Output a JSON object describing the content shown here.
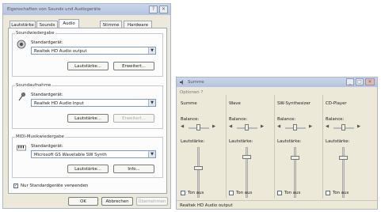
{
  "dialog": {
    "title": "Eigenschaften von Sounds und Audiogeräte",
    "tabs": [
      "Lautstärke",
      "Sounds",
      "Audio",
      "Stimme",
      "Hardware"
    ],
    "active_tab": "Audio",
    "playback": {
      "group_title": "Soundwiedergabe",
      "default_label": "Standardgerät:",
      "device": "Realtek HD Audio output",
      "volume_button": "Lautstärke...",
      "advanced_button": "Erweitert..."
    },
    "recording": {
      "group_title": "Soundaufnahme",
      "default_label": "Standardgerät:",
      "device": "Realtek HD Audio Input",
      "volume_button": "Lautstärke...",
      "advanced_button": "Erweitert..."
    },
    "midi": {
      "group_title": "MIDI-Musikwiedergabe",
      "default_label": "Standardgerät:",
      "device": "Microsoft GS Wavetable SW Synth",
      "volume_button": "Lautstärke...",
      "info_button": "Info..."
    },
    "use_default_only": "Nur Standardgeräte verwenden",
    "ok": "OK",
    "cancel": "Abbrechen",
    "apply": "Übernehmen"
  },
  "mixer": {
    "title": "Summe",
    "menu": "Optionen   ?",
    "balance_label": "Balance:",
    "volume_label": "Lautstärke:",
    "mute_label": "Ton aus",
    "columns": [
      {
        "name": "Summe"
      },
      {
        "name": "Wave"
      },
      {
        "name": "SW-Synthesizer"
      },
      {
        "name": "CD-Player"
      }
    ],
    "status": "Realtek HD Audio output"
  }
}
